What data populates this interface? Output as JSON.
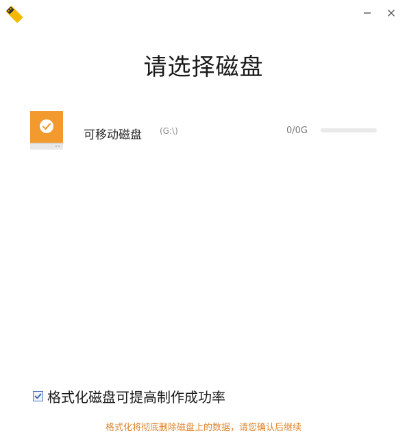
{
  "window": {
    "minimize_symbol": "—",
    "close_symbol": "✕",
    "logo_icon": "usb-drive-logo-icon"
  },
  "page": {
    "title": "请选择磁盘"
  },
  "disks": [
    {
      "name": "可移动磁盘",
      "path": "(G:\\)",
      "size": "0/0G",
      "usage_fraction": 0,
      "selected": true,
      "icon": "removable-disk-icon",
      "check_icon": "checkmark-icon"
    }
  ],
  "format_option": {
    "checked": true,
    "label": "格式化磁盘可提高制作成功率"
  },
  "warning": {
    "text": "格式化将彻底删除磁盘上的数据，请您确认后继续"
  },
  "colors": {
    "accent_orange": "#f29a2e",
    "warning_text": "#e0842a",
    "checkbox_border": "#4a78c2"
  }
}
